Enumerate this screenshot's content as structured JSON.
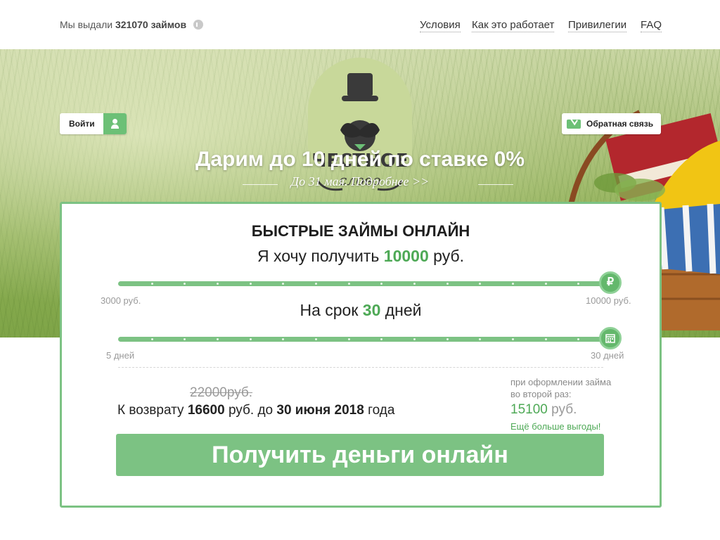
{
  "header": {
    "counter_prefix": "Мы выдали",
    "counter_value": "321070",
    "counter_suffix": "займов",
    "nav": [
      "Условия",
      "Как это работает",
      "Привилегии",
      "FAQ"
    ]
  },
  "hero": {
    "login_label": "Войти",
    "feedback_label": "Обратная связь",
    "logo_line1": "ЧЕСТНОЕ",
    "logo_line2": "слово",
    "promo_title": "Дарим до 10 дней по ставке 0%",
    "promo_subtitle": "До 31 мая. Подробнее >>"
  },
  "calculator": {
    "title": "БЫСТРЫЕ ЗАЙМЫ ОНЛАЙН",
    "want_prefix": "Я хочу получить",
    "amount": "10000",
    "currency": "руб.",
    "amount_min": "3000 руб.",
    "amount_max": "10000 руб.",
    "amount_slider_fraction": 1.0,
    "amount_knob_glyph": "₽",
    "term_prefix": "На срок",
    "term_value": "30",
    "term_suffix": "дней",
    "term_min": "5 дней",
    "term_max": "30 дней",
    "term_slider_fraction": 1.0,
    "old_price": "22000",
    "old_currency": "руб.",
    "return_prefix": "К возврату",
    "return_amount": "16600",
    "return_mid": "руб. до",
    "return_date": "30 июня 2018",
    "return_suffix": "года",
    "second_note": "при оформлении займа во второй раз:",
    "second_price": "15100",
    "second_currency": "руб.",
    "second_more": "Ещё больше выгоды!",
    "cta_label": "Получить деньги онлайн"
  },
  "colors": {
    "accent": "#7cc283",
    "accent_dark": "#4ea956"
  }
}
